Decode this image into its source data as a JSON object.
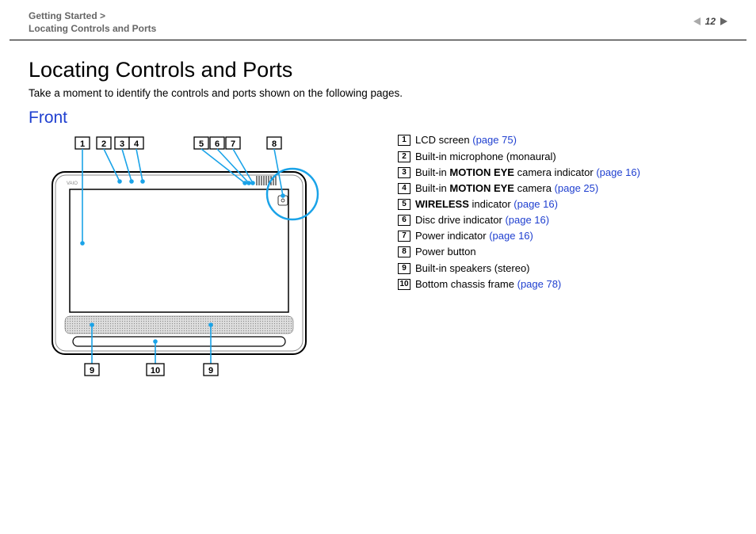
{
  "header": {
    "crumb1": "Getting Started >",
    "crumb2": "Locating Controls and Ports",
    "page": "12",
    "n_symbol": "n",
    "N_symbol": "N"
  },
  "title": "Locating Controls and Ports",
  "intro": "Take a moment to identify the controls and ports shown on the following pages.",
  "section": "Front",
  "top_callouts": [
    "1",
    "2",
    "3",
    "4",
    "5",
    "6",
    "7",
    "8"
  ],
  "bottom_callouts": [
    "9",
    "10",
    "9"
  ],
  "legend": [
    {
      "n": "1",
      "pre": "",
      "bold": "",
      "post": "LCD screen ",
      "link": "(page 75)"
    },
    {
      "n": "2",
      "pre": "",
      "bold": "",
      "post": "Built-in microphone (monaural)",
      "link": ""
    },
    {
      "n": "3",
      "pre": "Built-in ",
      "bold": "MOTION EYE",
      "post": " camera indicator ",
      "link": "(page 16)"
    },
    {
      "n": "4",
      "pre": "Built-in ",
      "bold": "MOTION EYE",
      "post": " camera ",
      "link": "(page 25)"
    },
    {
      "n": "5",
      "pre": "",
      "bold": "WIRELESS",
      "post": " indicator ",
      "link": "(page 16)"
    },
    {
      "n": "6",
      "pre": "",
      "bold": "",
      "post": "Disc drive indicator ",
      "link": "(page 16)"
    },
    {
      "n": "7",
      "pre": "",
      "bold": "",
      "post": "Power indicator ",
      "link": "(page 16)"
    },
    {
      "n": "8",
      "pre": "",
      "bold": "",
      "post": "Power button",
      "link": ""
    },
    {
      "n": "9",
      "pre": "",
      "bold": "",
      "post": "Built-in speakers (stereo)",
      "link": ""
    },
    {
      "n": "10",
      "pre": "",
      "bold": "",
      "post": "Bottom chassis frame ",
      "link": "(page 78)"
    }
  ]
}
